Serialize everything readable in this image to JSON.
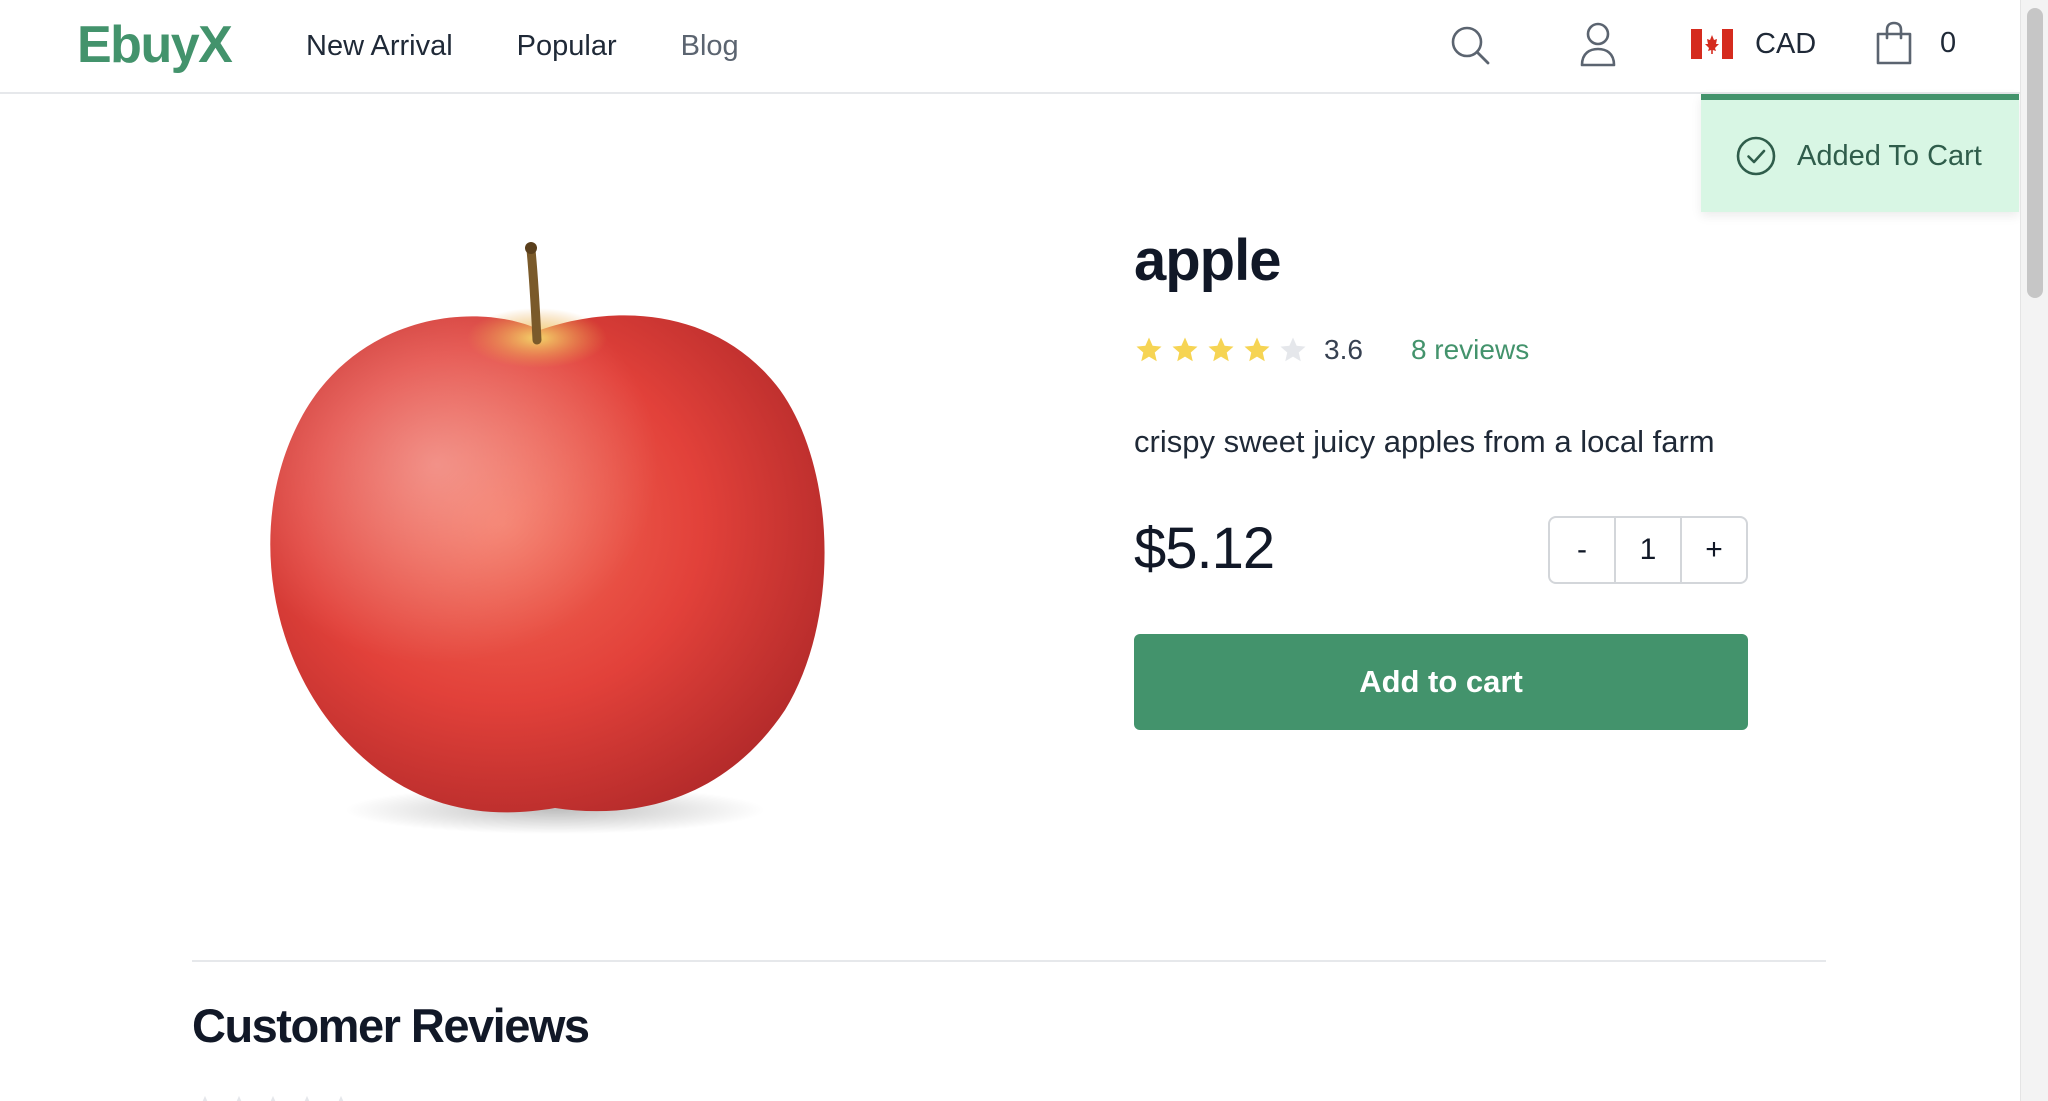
{
  "brand": {
    "name": "EbuyX",
    "color": "#43936c"
  },
  "nav": {
    "items": [
      {
        "label": "New Arrival"
      },
      {
        "label": "Popular"
      },
      {
        "label": "Blog"
      }
    ]
  },
  "header": {
    "search_icon": "search-icon",
    "user_icon": "user-icon",
    "currency": {
      "flag": "canada-flag-icon",
      "label": "CAD"
    },
    "cart": {
      "icon": "shopping-bag-icon",
      "count": "0"
    }
  },
  "toast": {
    "icon": "check-circle-icon",
    "message": "Added To Cart",
    "background": "#d8f6e4",
    "accent": "#43936c"
  },
  "product": {
    "title": "apple",
    "image": "red-apple-image",
    "rating": {
      "value": "3.6",
      "stars_filled": 4,
      "stars_total": 5
    },
    "reviews_link": "8 reviews",
    "description": "crispy sweet juicy apples from a local farm",
    "price": "$5.12",
    "quantity": {
      "decrement": "-",
      "value": "1",
      "increment": "+"
    },
    "add_to_cart": "Add to cart"
  },
  "reviews": {
    "heading": "Customer Reviews"
  },
  "colors": {
    "star_filled": "#f6d453",
    "star_empty": "#e5e7eb",
    "button": "#43936c"
  }
}
